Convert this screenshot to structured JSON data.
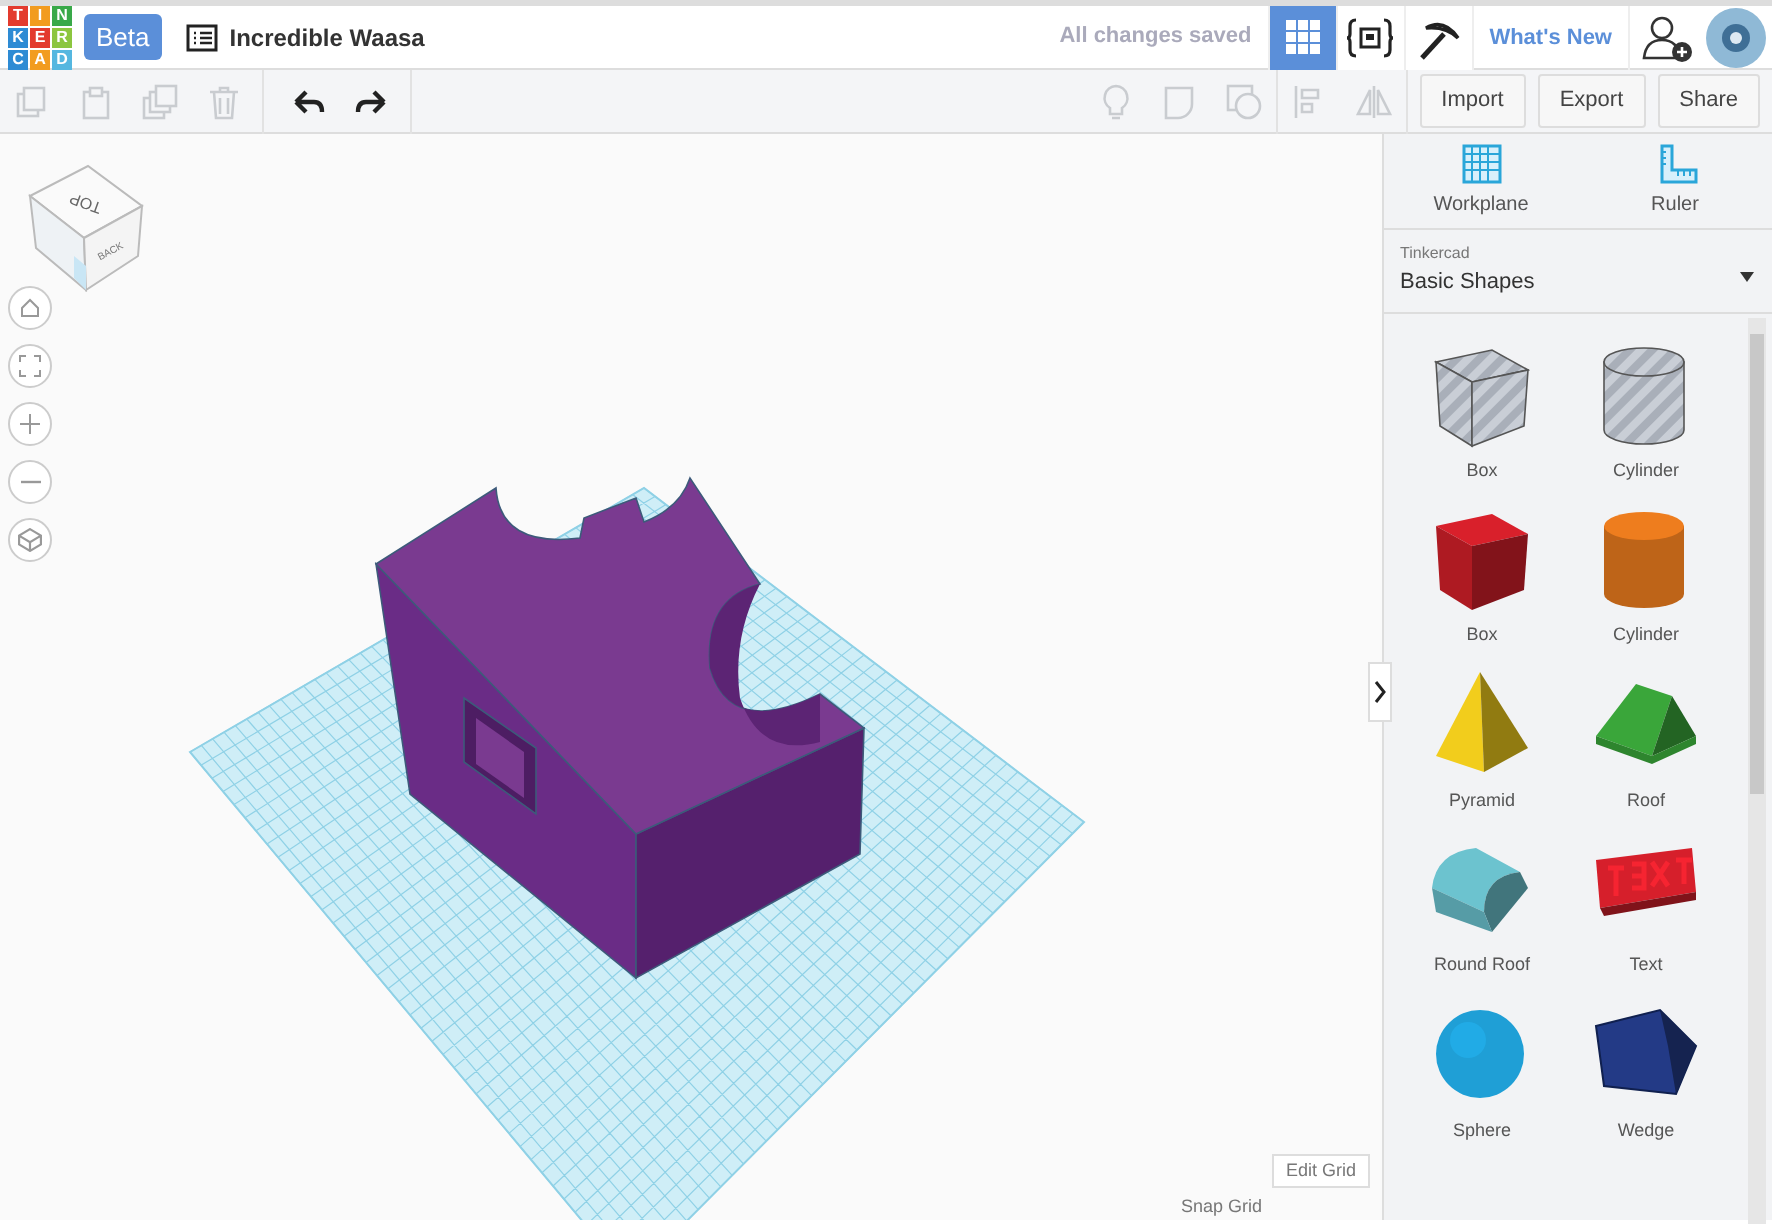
{
  "logo_letters": [
    "T",
    "I",
    "N",
    "K",
    "E",
    "R",
    "C",
    "A",
    "D"
  ],
  "badge": "Beta",
  "design_title": "Incredible Waasa",
  "save_status": "All changes saved",
  "view_modes": [
    {
      "selected": true
    },
    {
      "selected": false
    },
    {
      "selected": false
    }
  ],
  "whats_new": "What's New",
  "edit_tools": [
    {
      "disabled": true
    },
    {
      "disabled": true
    },
    {
      "disabled": true
    },
    {
      "disabled": true
    }
  ],
  "history_tools": [
    {
      "disabled": false
    },
    {
      "disabled": false
    }
  ],
  "shape_tools": [
    {
      "disabled": true
    },
    {
      "disabled": true
    },
    {
      "disabled": true
    },
    {
      "disabled": true
    },
    {
      "disabled": true
    }
  ],
  "actions": [
    "Import",
    "Export",
    "Share"
  ],
  "view_cube": {
    "top": "TOP",
    "back": "BACK"
  },
  "panel_tools": [
    "Workplane",
    "Ruler"
  ],
  "library": {
    "source": "Tinkercad",
    "name": "Basic Shapes"
  },
  "shapes": [
    {
      "kind": "box",
      "label": "Box",
      "color": "#b8bcc4",
      "hole": true
    },
    {
      "kind": "cylinder",
      "label": "Cylinder",
      "color": "#b8bcc4",
      "hole": true
    },
    {
      "kind": "box",
      "label": "Box",
      "color": "#d9202b",
      "hole": false
    },
    {
      "kind": "cylinder",
      "label": "Cylinder",
      "color": "#ee7d1e",
      "hole": false
    },
    {
      "kind": "pyramid",
      "label": "Pyramid",
      "color": "#f2cd1c",
      "hole": false
    },
    {
      "kind": "roof",
      "label": "Roof",
      "color": "#3aa63a",
      "hole": false
    },
    {
      "kind": "roundroof",
      "label": "Round Roof",
      "color": "#6cc3cf",
      "hole": false
    },
    {
      "kind": "text",
      "label": "Text",
      "color": "#d61f2b",
      "hole": false
    },
    {
      "kind": "sphere",
      "label": "Sphere",
      "color": "#1f9fd6",
      "hole": false
    },
    {
      "kind": "wedge",
      "label": "Wedge",
      "color": "#233a86",
      "hole": false
    }
  ],
  "edit_grid": "Edit Grid",
  "snap_grid": "Snap Grid"
}
